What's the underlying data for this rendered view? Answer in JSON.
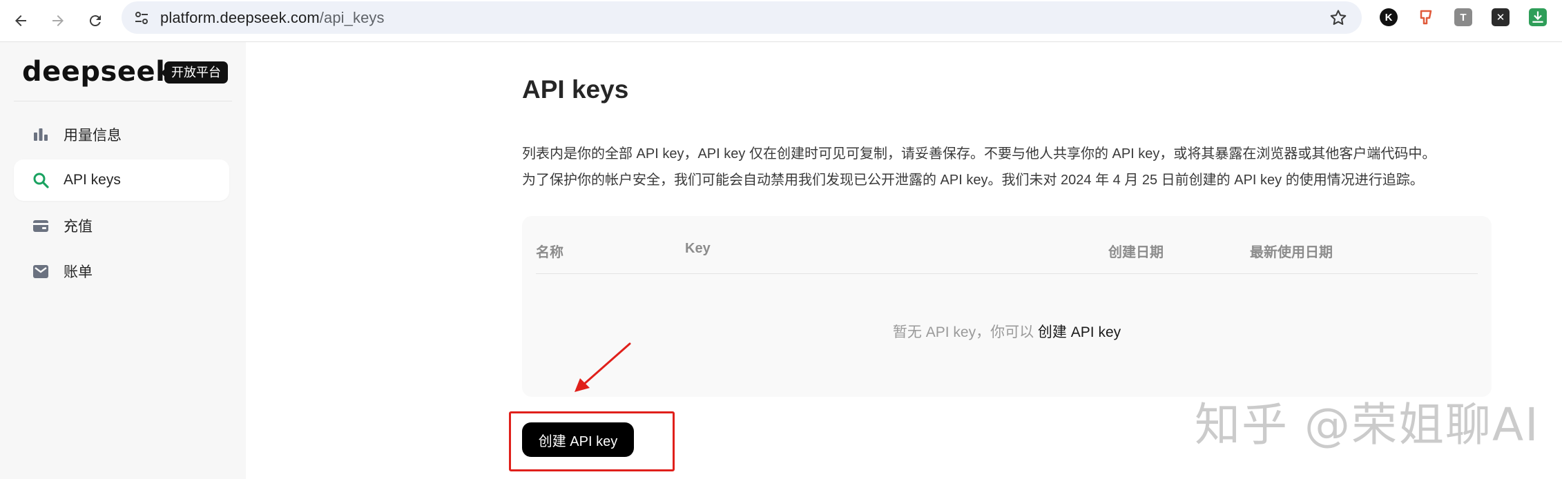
{
  "browser": {
    "url_host": "platform.deepseek.com",
    "url_path": "/api_keys"
  },
  "sidebar": {
    "logo_word": "deepseek",
    "logo_badge": "开放平台",
    "items": [
      {
        "label": "用量信息",
        "icon": "bar-chart-icon",
        "active": false
      },
      {
        "label": "API keys",
        "icon": "search-icon",
        "active": true
      },
      {
        "label": "充值",
        "icon": "wallet-icon",
        "active": false
      },
      {
        "label": "账单",
        "icon": "mail-icon",
        "active": false
      }
    ]
  },
  "main": {
    "title": "API keys",
    "desc_line1": "列表内是你的全部 API key，API key 仅在创建时可见可复制，请妥善保存。不要与他人共享你的 API key，或将其暴露在浏览器或其他客户端代码中。",
    "desc_line2": "为了保护你的帐户安全，我们可能会自动禁用我们发现已公开泄露的 API key。我们未对 2024 年 4 月 25 日前创建的 API key 的使用情况进行追踪。",
    "table": {
      "columns": [
        "名称",
        "Key",
        "创建日期",
        "最新使用日期"
      ],
      "empty_text": "暂无 API key，你可以",
      "empty_link": "创建 API key"
    },
    "create_button": "创建 API key"
  },
  "watermark": "知乎 @荣姐聊AI",
  "colors": {
    "accent_green": "#1aa260",
    "highlight_red": "#e0201b",
    "button_black": "#000000"
  }
}
